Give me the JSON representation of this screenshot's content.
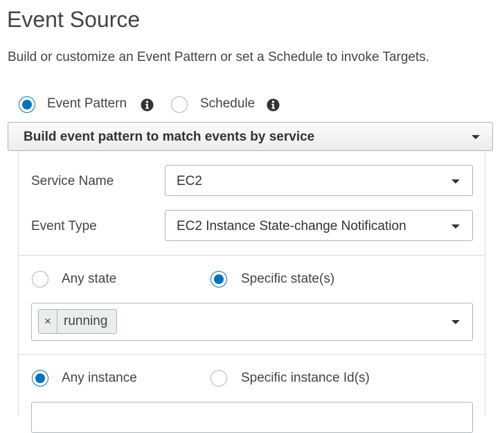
{
  "header": {
    "title": "Event Source",
    "subtitle": "Build or customize an Event Pattern or set a Schedule to invoke Targets."
  },
  "source_type": {
    "options": [
      {
        "label": "Event Pattern",
        "checked": true,
        "icon": "info-icon"
      },
      {
        "label": "Schedule",
        "checked": false,
        "icon": "info-icon"
      }
    ]
  },
  "pattern_mode": {
    "selected": "Build event pattern to match events by service"
  },
  "service": {
    "name_label": "Service Name",
    "name_value": "EC2",
    "type_label": "Event Type",
    "type_value": "EC2 Instance State-change Notification"
  },
  "state": {
    "any_label": "Any state",
    "any_checked": false,
    "specific_label": "Specific state(s)",
    "specific_checked": true,
    "tokens": [
      {
        "remove": "×",
        "label": "running"
      }
    ]
  },
  "instance": {
    "any_label": "Any instance",
    "any_checked": true,
    "specific_label": "Specific instance Id(s)",
    "specific_checked": false
  },
  "colors": {
    "accent": "#0073bb",
    "border": "#aab7b8",
    "divider": "#d5dbdb"
  }
}
